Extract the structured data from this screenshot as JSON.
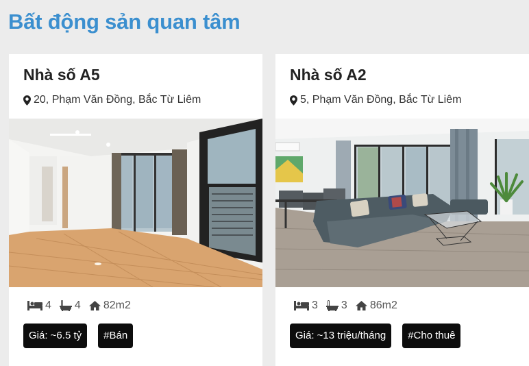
{
  "section": {
    "title": "Bất động sản quan tâm"
  },
  "listings": [
    {
      "title": "Nhà số A5",
      "address": "20, Phạm Văn Đồng, Bắc Từ Liêm",
      "bedrooms": "4",
      "bathrooms": "4",
      "area": "82m2",
      "price_tag": "Giá: ~6.5 tỷ",
      "type_tag": "#Bán"
    },
    {
      "title": "Nhà số A2",
      "address": "5, Phạm Văn Đồng, Bắc Từ Liêm",
      "bedrooms": "3",
      "bathrooms": "3",
      "area": "86m2",
      "price_tag": "Giá: ~13 triệu/tháng",
      "type_tag": "#Cho thuê"
    }
  ],
  "icons": {
    "address": "map-marker-icon",
    "bedrooms": "bed-icon",
    "bathrooms": "bath-icon",
    "area": "home-icon"
  },
  "colors": {
    "title": "#3b8fcf",
    "tag_bg": "#0d0d0d",
    "page_bg": "#ececec"
  }
}
